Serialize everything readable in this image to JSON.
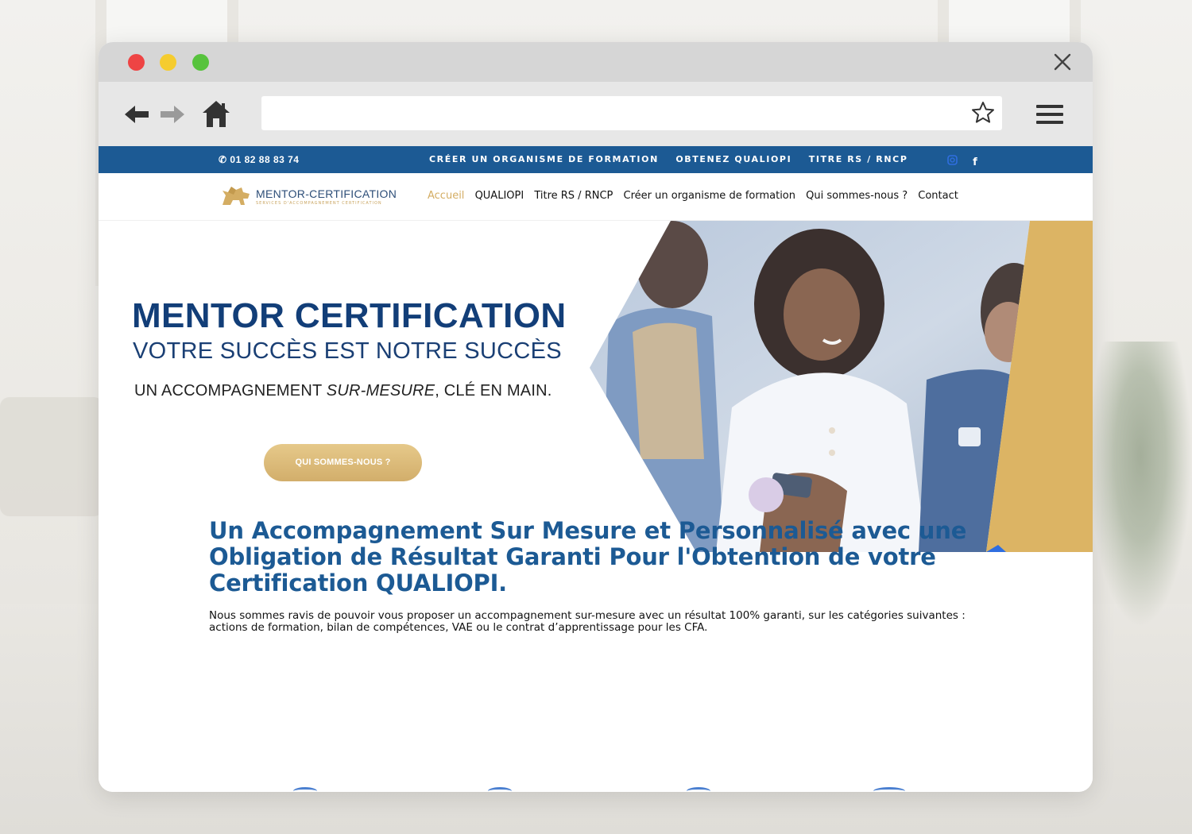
{
  "browser": {
    "url_value": "",
    "url_placeholder": ""
  },
  "topbar": {
    "phone": "01 82 88 83 74",
    "links": [
      "CRÉER UN ORGANISME DE FORMATION",
      "OBTENEZ QUALIOPI",
      "TITRE RS / RNCP"
    ],
    "social": [
      "instagram-icon",
      "facebook-icon"
    ]
  },
  "site": {
    "logo_name": "MENTOR-CERTIFICATION",
    "logo_tagline": "SERVICES D'ACCOMPAGNEMENT CERTIFICATION",
    "menu": {
      "home": "Accueil",
      "qualiopi": "QUALIOPI",
      "titre": "Titre RS / RNCP",
      "creer": "Créer un organisme de formation",
      "qui": "Qui sommes-nous ?",
      "contact": "Contact"
    }
  },
  "hero": {
    "title": "MENTOR CERTIFICATION",
    "subtitle": "VOTRE SUCCÈS EST NOTRE SUCCÈS",
    "tagline_pre": "UN ACCOMPAGNEMENT ",
    "tagline_em": "SUR-MESURE",
    "tagline_post": ", CLÉ EN MAIN.",
    "button": "QUI SOMMES-NOUS ?"
  },
  "intro": {
    "heading": "Un Accompagnement Sur Mesure et Personnalisé avec une Obligation de Résultat Garanti Pour l'Obtention de votre Certification QUALIOPI.",
    "body": "Nous sommes ravis de pouvoir vous proposer un accompagnement sur-mesure avec un résultat 100% garanti, sur les catégories suivantes : actions de formation, bilan de compétences, VAE ou le contrat d’apprentissage pour les CFA."
  },
  "colors": {
    "brand_blue": "#1c5a94",
    "gold": "#d4ad63",
    "title_blue": "#123e78"
  }
}
